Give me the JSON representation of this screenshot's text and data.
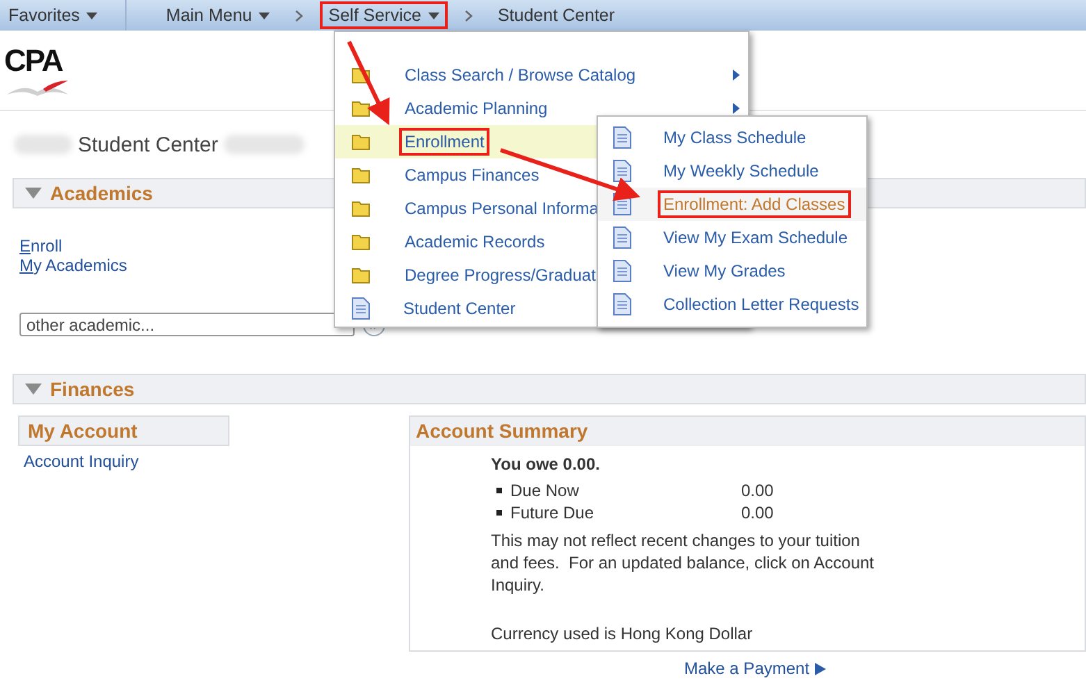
{
  "nav": [
    {
      "kind": "menu",
      "label": "Favorites",
      "highlighted": false
    },
    {
      "kind": "menu",
      "label": "Main Menu",
      "highlighted": false
    },
    {
      "kind": "crumb",
      "label": "Self Service",
      "dropdown": true,
      "highlighted": true
    },
    {
      "kind": "crumb",
      "label": "Student Center",
      "dropdown": false,
      "highlighted": false
    }
  ],
  "logo": "CPA",
  "page_title": "Student Center",
  "academics": {
    "title": "Academics",
    "links": [
      "Enroll",
      "My Academics"
    ],
    "select": {
      "value": "other academic..."
    }
  },
  "finances": {
    "title": "Finances",
    "my_account": {
      "title": "My Account",
      "links": [
        "Account Inquiry"
      ]
    },
    "account_summary": {
      "title": "Account Summary",
      "owe": "You owe 0.00.",
      "items": [
        {
          "label": "Due Now",
          "amount": "0.00"
        },
        {
          "label": "Future Due",
          "amount": "0.00"
        }
      ],
      "note": "This may not reflect recent changes to your tuition and fees.  For an updated balance, click on Account Inquiry.",
      "currency": "Currency used is Hong Kong Dollar"
    },
    "payment_link": "Make a Payment"
  },
  "self_service_menu": [
    {
      "kind": "folder",
      "label": "Class Search / Browse Catalog",
      "has_submenu": true,
      "selected": false,
      "highlighted": false
    },
    {
      "kind": "folder",
      "label": "Academic Planning",
      "has_submenu": true,
      "selected": false,
      "highlighted": false
    },
    {
      "kind": "folder",
      "label": "Enrollment",
      "selected": true,
      "highlighted": true
    },
    {
      "kind": "folder",
      "label": "Campus Finances",
      "selected": false,
      "highlighted": false
    },
    {
      "kind": "folder",
      "label": "Campus Personal Informa",
      "selected": false,
      "highlighted": false
    },
    {
      "kind": "folder",
      "label": "Academic Records",
      "selected": false,
      "highlighted": false
    },
    {
      "kind": "folder",
      "label": "Degree Progress/Graduat",
      "selected": false,
      "highlighted": false
    },
    {
      "kind": "page",
      "label": "Student Center",
      "selected": false,
      "highlighted": false
    }
  ],
  "enrollment_submenu": [
    {
      "kind": "page",
      "label": "My Class Schedule",
      "selected": false,
      "highlighted": false
    },
    {
      "kind": "page",
      "label": "My Weekly Schedule",
      "selected": false,
      "highlighted": false
    },
    {
      "kind": "page",
      "label": "Enrollment: Add Classes",
      "selected": true,
      "highlighted": true
    },
    {
      "kind": "page",
      "label": "View My Exam Schedule",
      "selected": false,
      "highlighted": false
    },
    {
      "kind": "page",
      "label": "View My Grades",
      "selected": false,
      "highlighted": false
    },
    {
      "kind": "page",
      "label": "Collection Letter Requests",
      "selected": false,
      "highlighted": false
    }
  ]
}
